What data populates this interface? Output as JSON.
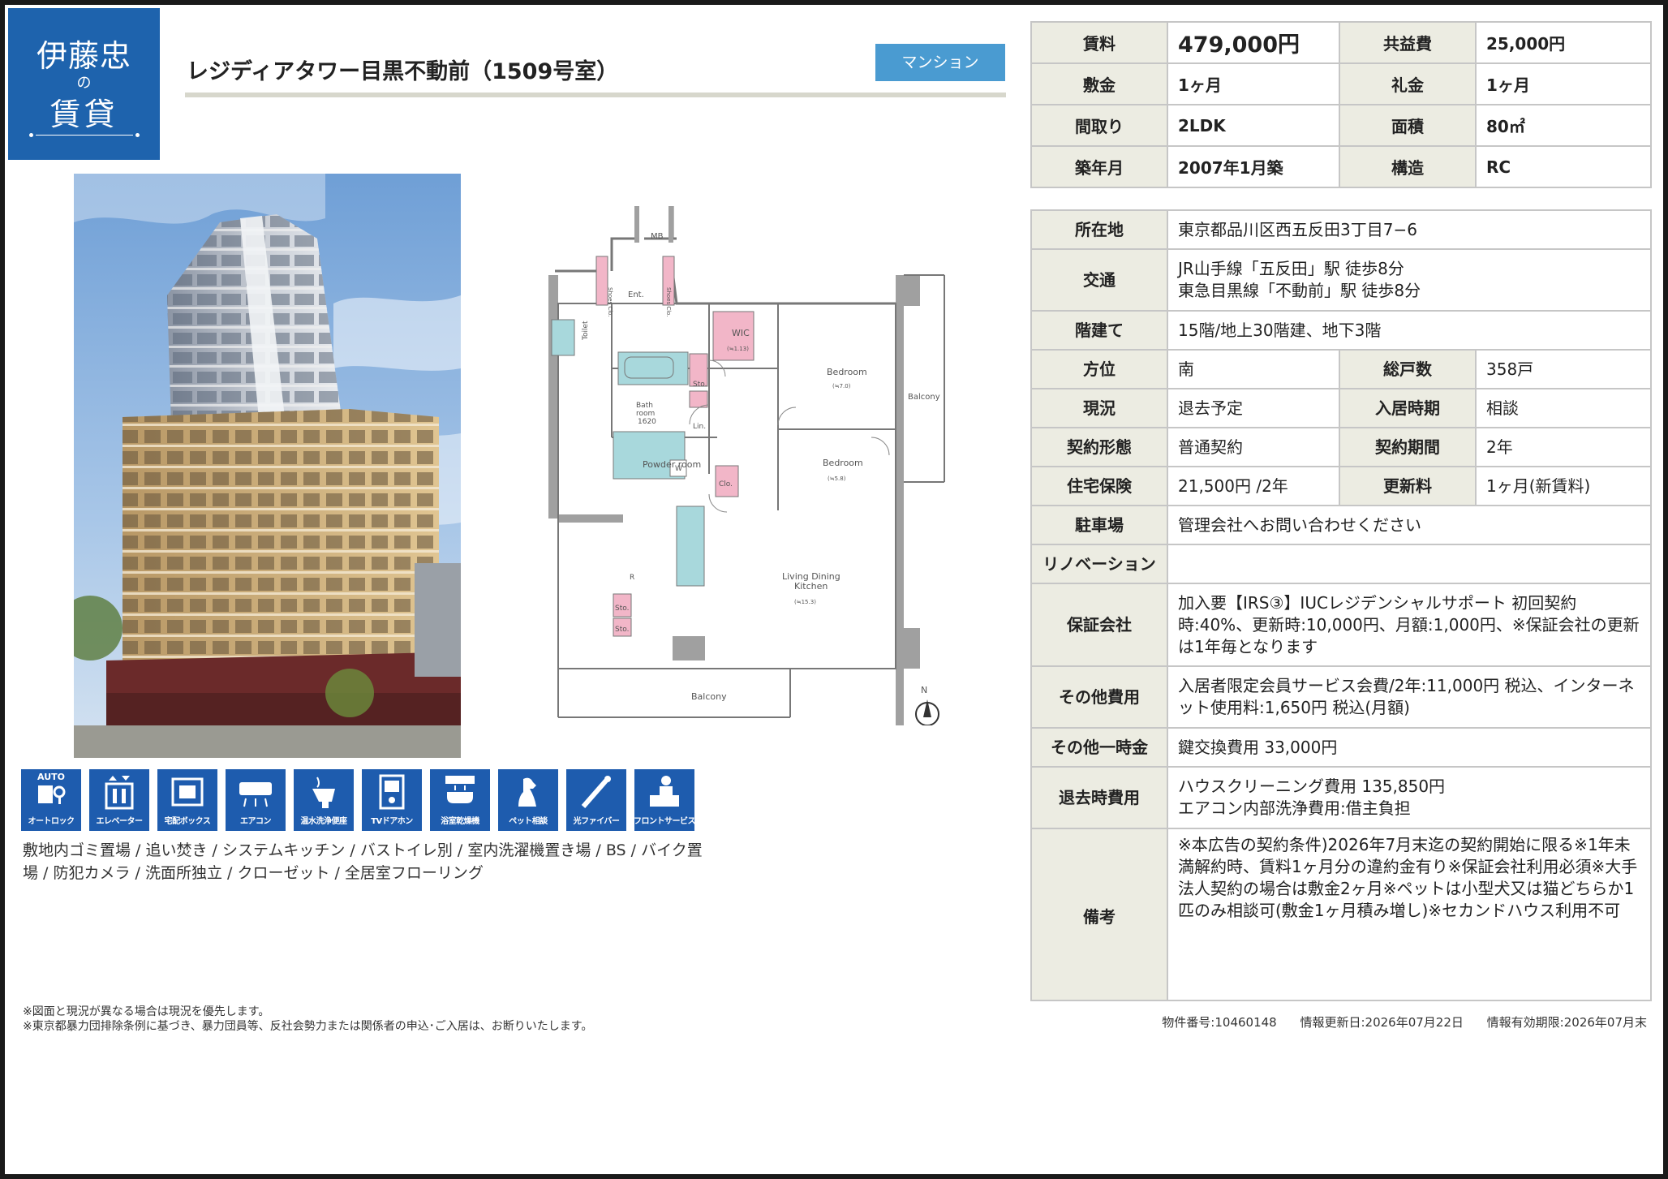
{
  "logo": {
    "line1": "伊藤忠",
    "line2": "の",
    "line3": "賃貸"
  },
  "property": {
    "name": "レジディアタワー目黒不動前（1509号室）",
    "type_badge": "マンション"
  },
  "summary": [
    {
      "l1": "賃料",
      "v1": "479,000円",
      "l2": "共益費",
      "v2": "25,000円"
    },
    {
      "l1": "敷金",
      "v1": "1ヶ月",
      "l2": "礼金",
      "v2": "1ヶ月"
    },
    {
      "l1": "間取り",
      "v1": "2LDK",
      "l2": "面積",
      "v2": "80㎡"
    },
    {
      "l1": "築年月",
      "v1": "2007年1月築",
      "l2": "構造",
      "v2": "RC"
    }
  ],
  "details": {
    "address": {
      "label": "所在地",
      "value": "東京都品川区西五反田3丁目7−6"
    },
    "transport": {
      "label": "交通",
      "line1": "JR山手線「五反田」駅 徒歩8分",
      "line2": "東急目黒線「不動前」駅 徒歩8分"
    },
    "floors": {
      "label": "階建て",
      "value": "15階/地上30階建、地下3階"
    },
    "direction": {
      "label": "方位",
      "value": "南",
      "label2": "総戸数",
      "value2": "358戸"
    },
    "status": {
      "label": "現況",
      "value": "退去予定",
      "label2": "入居時期",
      "value2": "相談"
    },
    "contract": {
      "label": "契約形態",
      "value": "普通契約",
      "label2": "契約期間",
      "value2": "2年"
    },
    "insurance": {
      "label": "住宅保険",
      "value": "21,500円 /2年",
      "label2": "更新料",
      "value2": "1ヶ月(新賃料)"
    },
    "parking": {
      "label": "駐車場",
      "value": "管理会社へお問い合わせください"
    },
    "renovation": {
      "label": "リノベーション",
      "value": ""
    },
    "guarantor": {
      "label": "保証会社",
      "value": "加入要【IRS③】IUCレジデンシャルサポート 初回契約時:40%、更新時:10,000円、月額:1,000円、※保証会社の更新は1年毎となります"
    },
    "other_fees": {
      "label": "その他費用",
      "value": "入居者限定会員サービス会費/2年:11,000円 税込、インターネット使用料:1,650円 税込(月額)"
    },
    "one_time": {
      "label": "その他一時金",
      "value": "鍵交換費用 33,000円"
    },
    "moveout": {
      "label": "退去時費用",
      "line1": "ハウスクリーニング費用 135,850円",
      "line2": "エアコン内部洗浄費用:借主負担"
    },
    "remarks": {
      "label": "備考",
      "value": "※本広告の契約条件)2026年7月末迄の契約開始に限る※1年未満解約時、賃料1ヶ月分の違約金有り※保証会社利用必須※大手法人契約の場合は敷金2ヶ月※ペットは小型犬又は猫どちらか1匹のみ相談可(敷金1ヶ月積み増し)※セカンドハウス利用不可"
    }
  },
  "floorplan": {
    "labels": {
      "mb": "MB",
      "shoes1": "Shoes Clo.",
      "ent": "Ent.",
      "shoes2": "Shoes Clo.",
      "toilet": "Toilet",
      "wic": "WIC",
      "wic_area": "(≒1.13)",
      "bedroom1": "Bedroom",
      "bedroom1_area": "(≒7.0)",
      "balcony_side": "Balcony",
      "sto1": "Sto.",
      "bath": "Bath",
      "bath2": "room",
      "bath3": "1620",
      "lin": "Lin.",
      "powder": "Powder room",
      "w": "W",
      "bedroom2": "Bedroom",
      "bedroom2_area": "(≒5.8)",
      "clo": "Clo.",
      "r": "R",
      "ldk1": "Living Dining",
      "ldk2": "Kitchen",
      "ldk_area": "(≒15.3)",
      "sto2": "Sto.",
      "sto3": "Sto.",
      "balcony_bottom": "Balcony",
      "north": "N"
    }
  },
  "amenities": [
    {
      "label": "オートロック",
      "icon": "autolock-icon",
      "top": "AUTO"
    },
    {
      "label": "エレベーター",
      "icon": "elevator-icon"
    },
    {
      "label": "宅配ボックス",
      "icon": "delivery-box-icon"
    },
    {
      "label": "エアコン",
      "icon": "air-conditioner-icon"
    },
    {
      "label": "温水洗浄便座",
      "icon": "washlet-icon"
    },
    {
      "label": "TVドアホン",
      "icon": "tv-intercom-icon"
    },
    {
      "label": "浴室乾燥機",
      "icon": "bath-dryer-icon"
    },
    {
      "label": "ペット相談",
      "icon": "pet-icon"
    },
    {
      "label": "光ファイバー",
      "icon": "fiber-icon"
    },
    {
      "label": "フロントサービス",
      "icon": "front-service-icon"
    }
  ],
  "equipment": "敷地内ゴミ置場 / 追い焚き / システムキッチン / バストイレ別 / 室内洗濯機置き場 / BS / バイク置場 / 防犯カメラ / 洗面所独立 / クローゼット / 全居室フローリング",
  "footnotes": {
    "line1": "※図面と現況が異なる場合は現況を優先します。",
    "line2": "※東京都暴力団排除条例に基づき、暴力団員等、反社会勢力または関係者の申込･ご入居は、お断りいたします。"
  },
  "meta": {
    "property_no": "物件番号:10460148",
    "updated": "情報更新日:2026年07月22日",
    "valid": "情報有効期限:2026年07月末"
  },
  "colors": {
    "brand_blue": "#1e63ad",
    "badge_blue": "#4a9bd1",
    "header_bg": "#ecece2",
    "plan_pink": "#f2b6c8",
    "plan_teal": "#a8d8dc"
  }
}
